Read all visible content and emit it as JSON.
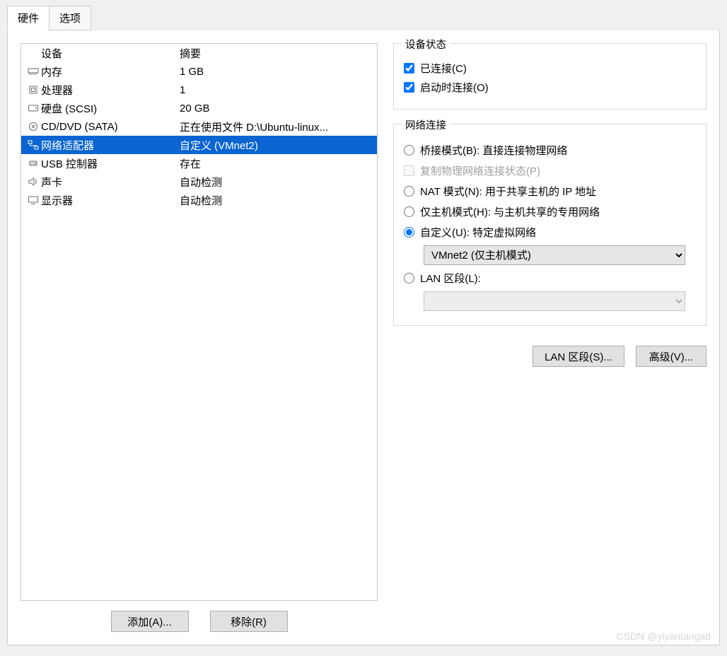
{
  "tabs": {
    "hardware": "硬件",
    "options": "选项"
  },
  "headers": {
    "device": "设备",
    "summary": "摘要"
  },
  "devices": [
    {
      "icon": "memory",
      "name": "内存",
      "summary": "1 GB"
    },
    {
      "icon": "cpu",
      "name": "处理器",
      "summary": "1"
    },
    {
      "icon": "disk",
      "name": "硬盘 (SCSI)",
      "summary": "20 GB"
    },
    {
      "icon": "cd",
      "name": "CD/DVD (SATA)",
      "summary": "正在使用文件 D:\\Ubuntu-linux..."
    },
    {
      "icon": "network",
      "name": "网络适配器",
      "summary": "自定义 (VMnet2)",
      "selected": true
    },
    {
      "icon": "usb",
      "name": "USB 控制器",
      "summary": "存在"
    },
    {
      "icon": "sound",
      "name": "声卡",
      "summary": "自动检测"
    },
    {
      "icon": "display",
      "name": "显示器",
      "summary": "自动检测"
    }
  ],
  "buttons": {
    "add": "添加(A)...",
    "remove": "移除(R)",
    "lan_segments": "LAN 区段(S)...",
    "advanced": "高级(V)..."
  },
  "device_state": {
    "title": "设备状态",
    "connected": "已连接(C)",
    "connect_at_power_on": "启动时连接(O)"
  },
  "network": {
    "title": "网络连接",
    "bridged": "桥接模式(B): 直接连接物理网络",
    "replicate": "复制物理网络连接状态(P)",
    "nat": "NAT 模式(N): 用于共享主机的 IP 地址",
    "host_only": "仅主机模式(H): 与主机共享的专用网络",
    "custom": "自定义(U): 特定虚拟网络",
    "custom_value": "VMnet2 (仅主机模式)",
    "lan_segment": "LAN 区段(L):"
  },
  "watermark": "CSDN @yiyantangad"
}
